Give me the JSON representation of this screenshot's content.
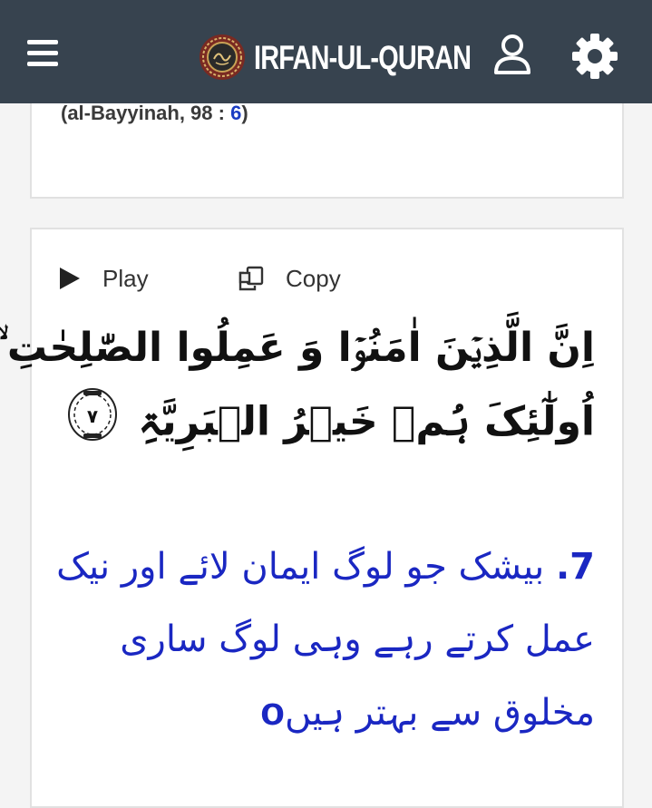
{
  "header": {
    "brand": "IRFAN-UL-QURAN",
    "menu_icon": "hamburger-menu-icon",
    "profile_icon": "user-icon",
    "settings_icon": "gear-icon",
    "bar_color": "#37434f"
  },
  "card_prev": {
    "ref_open": "(al-Bayyinah, 98 : ",
    "ref_num": "6",
    "ref_close": ")"
  },
  "card_current": {
    "play_label": "Play",
    "copy_label": "Copy",
    "arabic_line1": "اِنَّ الَّذِیۡنَ اٰمَنُوۡا وَ عَمِلُوا الصّٰلِحٰتِ ۙ",
    "arabic_line2": "اُولٰٓئِکَ ہُمۡ خَیۡرُ الۡبَرِیَّۃِ",
    "ayah_number": "۷",
    "verse_number": "7.",
    "urdu_text": "بیشک جو لوگ ایمان لائے اور نیک عمل کرتے رہے وہی لوگ ساری مخلوق سے بہتر ہیں",
    "end_mark": "o"
  }
}
